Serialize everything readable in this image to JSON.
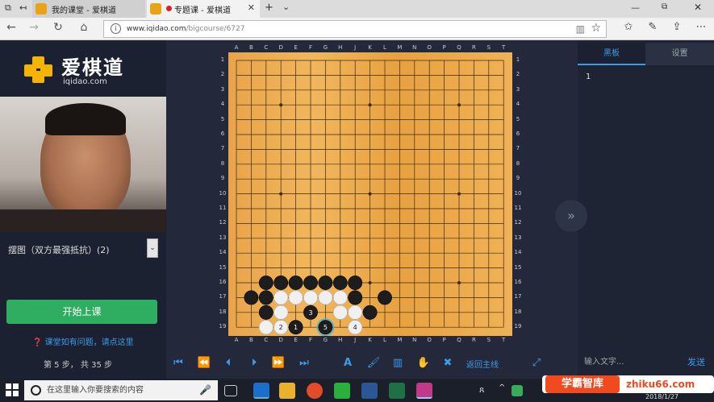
{
  "browser": {
    "tabs": [
      {
        "label": "我的课堂 - 爱棋道"
      },
      {
        "label": "专题课 - 爱棋道"
      }
    ],
    "url_host": "www.iqidao.com",
    "url_path": "/bigcourse/6727"
  },
  "brand": {
    "name": "爱棋道",
    "domain": "iqidao.com"
  },
  "lesson": {
    "selector": "摆图（双方最强抵抗）(2)",
    "start_label": "开始上课",
    "help": "课堂如有问题，请点这里",
    "step_info": "第 5 步， 共 35 步"
  },
  "board": {
    "columns": [
      "A",
      "B",
      "C",
      "D",
      "E",
      "F",
      "G",
      "H",
      "J",
      "K",
      "L",
      "M",
      "N",
      "O",
      "P",
      "Q",
      "R",
      "S"
    ],
    "rows": [
      "1",
      "2",
      "3",
      "4",
      "5",
      "6",
      "7",
      "8",
      "9",
      "10",
      "11",
      "12",
      "13",
      "14",
      "15",
      "16",
      "17",
      "18",
      "19"
    ],
    "extra_column": "T",
    "stones": [
      {
        "c": 2,
        "r": 15,
        "color": "black"
      },
      {
        "c": 3,
        "r": 15,
        "color": "black"
      },
      {
        "c": 4,
        "r": 15,
        "color": "black"
      },
      {
        "c": 5,
        "r": 15,
        "color": "black"
      },
      {
        "c": 6,
        "r": 15,
        "color": "black"
      },
      {
        "c": 7,
        "r": 15,
        "color": "black"
      },
      {
        "c": 8,
        "r": 15,
        "color": "black"
      },
      {
        "c": 1,
        "r": 16,
        "color": "black"
      },
      {
        "c": 2,
        "r": 16,
        "color": "black"
      },
      {
        "c": 3,
        "r": 16,
        "color": "white"
      },
      {
        "c": 4,
        "r": 16,
        "color": "white"
      },
      {
        "c": 5,
        "r": 16,
        "color": "white"
      },
      {
        "c": 6,
        "r": 16,
        "color": "white"
      },
      {
        "c": 7,
        "r": 16,
        "color": "white"
      },
      {
        "c": 8,
        "r": 16,
        "color": "black"
      },
      {
        "c": 10,
        "r": 16,
        "color": "black"
      },
      {
        "c": 2,
        "r": 17,
        "color": "black"
      },
      {
        "c": 3,
        "r": 17,
        "color": "white"
      },
      {
        "c": 5,
        "r": 17,
        "color": "black",
        "label": "3"
      },
      {
        "c": 7,
        "r": 17,
        "color": "white"
      },
      {
        "c": 8,
        "r": 17,
        "color": "white"
      },
      {
        "c": 9,
        "r": 17,
        "color": "black"
      },
      {
        "c": 2,
        "r": 18,
        "color": "white"
      },
      {
        "c": 3,
        "r": 18,
        "color": "white",
        "label": "2"
      },
      {
        "c": 4,
        "r": 18,
        "color": "black",
        "label": "1"
      },
      {
        "c": 6,
        "r": 18,
        "color": "black",
        "label": "5"
      },
      {
        "c": 8,
        "r": 18,
        "color": "white",
        "label": "4"
      }
    ],
    "star_points": [
      [
        3,
        3
      ],
      [
        9,
        3
      ],
      [
        15,
        3
      ],
      [
        3,
        9
      ],
      [
        9,
        9
      ],
      [
        15,
        9
      ],
      [
        3,
        15
      ],
      [
        9,
        15
      ],
      [
        15,
        15
      ]
    ]
  },
  "right_panel": {
    "tab_blackboard": "黑板",
    "tab_settings": "设置",
    "move_number": "1",
    "chat_placeholder": "输入文字...",
    "send_label": "发送"
  },
  "toolbar": {
    "main_line": "返回主线"
  },
  "taskbar": {
    "search_placeholder": "在这里输入你要搜索的内容",
    "date": "2018/1/27"
  },
  "watermark": {
    "left": "学霸智库",
    "right": "zhiku66.com"
  }
}
